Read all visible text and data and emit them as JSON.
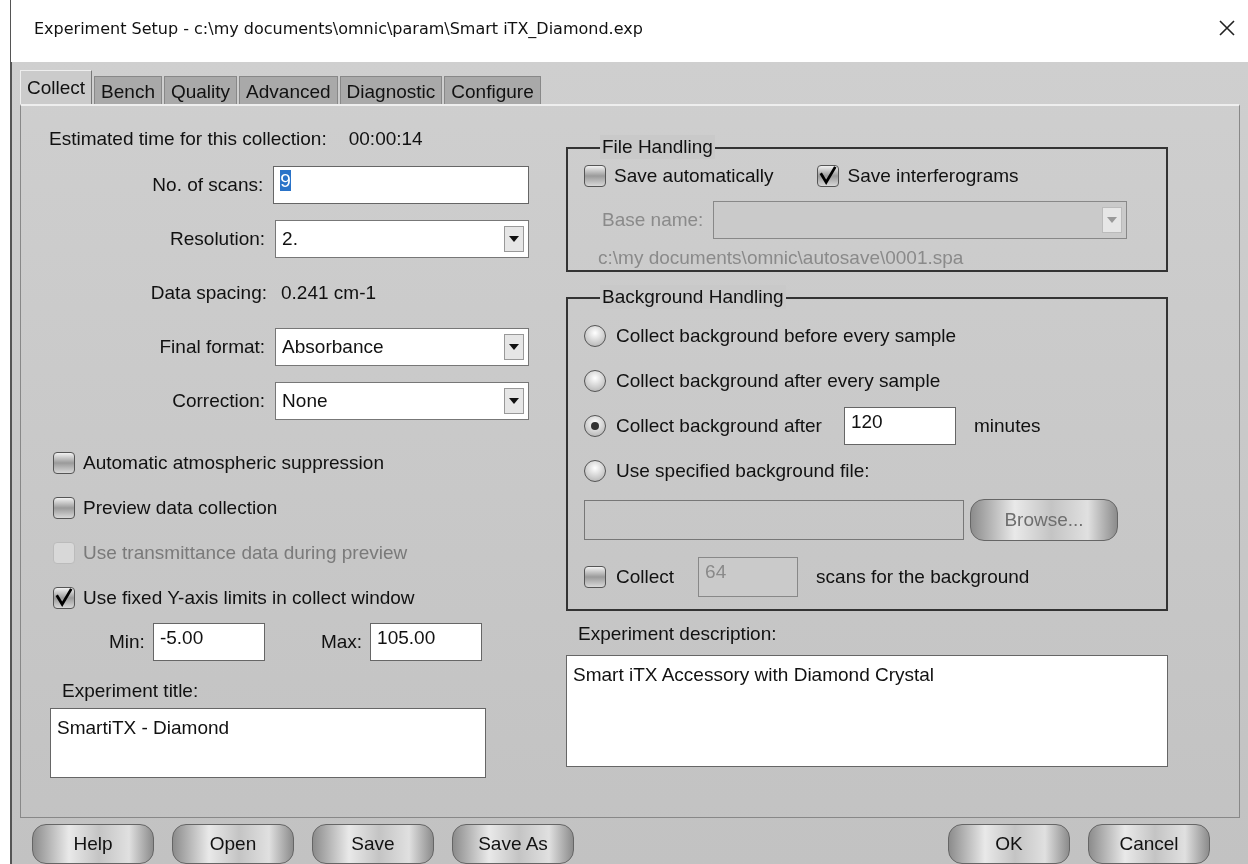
{
  "window": {
    "title": "Experiment Setup - c:\\my documents\\omnic\\param\\Smart iTX_Diamond.exp"
  },
  "tabs": [
    {
      "label": "Collect",
      "selected": true
    },
    {
      "label": "Bench",
      "selected": false
    },
    {
      "label": "Quality",
      "selected": false
    },
    {
      "label": "Advanced",
      "selected": false
    },
    {
      "label": "Diagnostic",
      "selected": false
    },
    {
      "label": "Configure",
      "selected": false
    }
  ],
  "estimated_time": {
    "label": "Estimated time for this collection:",
    "value": "00:00:14"
  },
  "fields": [
    {
      "kind": "input",
      "label": "No. of scans:",
      "value": "9",
      "value_selected": true
    },
    {
      "kind": "dropdown",
      "label": "Resolution:",
      "value": "2."
    },
    {
      "kind": "readout",
      "label": "Data spacing:",
      "value": "0.241 cm-1"
    },
    {
      "kind": "dropdown",
      "label": "Final format:",
      "value": "Absorbance"
    },
    {
      "kind": "dropdown",
      "label": "Correction:",
      "value": "None"
    }
  ],
  "options": [
    {
      "label": "Automatic atmospheric suppression",
      "checked": false,
      "disabled": false
    },
    {
      "label": "Preview data collection",
      "checked": false,
      "disabled": false
    },
    {
      "label": "Use transmittance data during preview",
      "checked": false,
      "disabled": true
    },
    {
      "label": "Use fixed Y-axis limits in collect window",
      "checked": true,
      "disabled": false
    }
  ],
  "y_limits": {
    "min_label": "Min:",
    "min": "-5.00",
    "max_label": "Max:",
    "max": "105.00"
  },
  "experiment_title": {
    "label": "Experiment title:",
    "value": "SmartiTX - Diamond"
  },
  "file_handling": {
    "title": "File Handling",
    "checks": [
      {
        "label": "Save automatically",
        "checked": false
      },
      {
        "label": "Save interferograms",
        "checked": true
      }
    ],
    "base_name": {
      "label": "Base name:",
      "disabled": true
    },
    "path": "c:\\my documents\\omnic\\autosave\\0001.spa"
  },
  "background_handling": {
    "title": "Background Handling",
    "options": [
      {
        "kind": "plain",
        "label": "Collect background before every sample",
        "selected": false
      },
      {
        "kind": "plain",
        "label": "Collect background after every sample",
        "selected": false
      },
      {
        "kind": "minutes",
        "label": "Collect background after",
        "selected": true,
        "value": "120",
        "unit": "minutes"
      },
      {
        "kind": "plain",
        "label": "Use specified background file:",
        "selected": false
      }
    ],
    "file": {
      "disabled": true,
      "button": "Browse..."
    },
    "scans": {
      "label": "Collect",
      "checked": false,
      "value": "64",
      "disabled": true,
      "suffix": "scans for the background"
    }
  },
  "experiment_description": {
    "label": "Experiment description:",
    "value": "Smart iTX Accessory with Diamond Crystal"
  },
  "buttons_left": [
    "Help",
    "Open",
    "Save",
    "Save As"
  ],
  "buttons_right": [
    "OK",
    "Cancel"
  ]
}
